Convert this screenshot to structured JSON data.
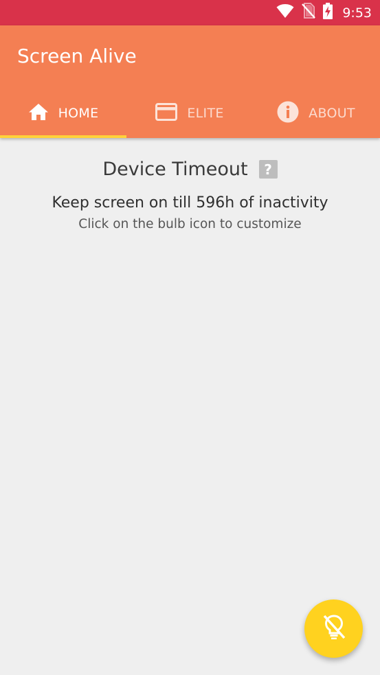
{
  "status_bar": {
    "time": "9:53",
    "background_color": "#d9324a",
    "icons": [
      "wifi-icon",
      "no-sim-icon",
      "battery-charging-icon"
    ]
  },
  "app": {
    "title": "Screen Alive",
    "primary_color": "#f47f53",
    "accent_color": "#ffd23a"
  },
  "tabs": [
    {
      "label": "HOME",
      "icon": "home-icon",
      "active": true
    },
    {
      "label": "ELITE",
      "icon": "credit-card-icon",
      "active": false
    },
    {
      "label": "ABOUT",
      "icon": "info-icon",
      "active": false
    }
  ],
  "home": {
    "timeout_title": "Device Timeout",
    "help_icon": "help-icon",
    "help_glyph": "?",
    "keep_screen_text": "Keep screen on till 596h of inactivity",
    "hint_text": "Click on the bulb icon to customize"
  },
  "fab": {
    "icon": "bulb-off-icon",
    "color": "#ffd21f"
  }
}
